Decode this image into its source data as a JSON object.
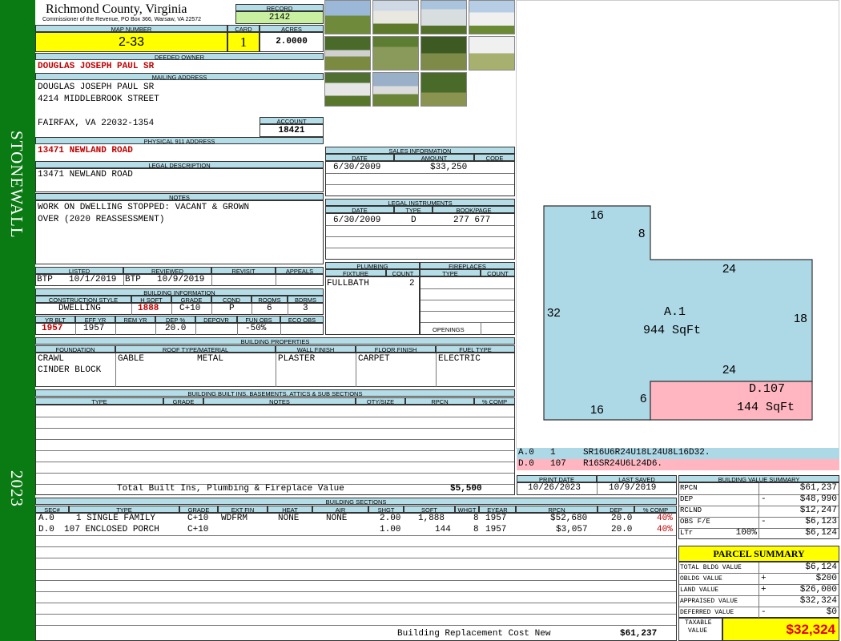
{
  "sidebar": {
    "district": "STONEWALL",
    "year": "2023"
  },
  "header": {
    "county": "Richmond County, Virginia",
    "commissioner": "Commissioner of the Revenue, PO Box 366, Warsaw, VA 22572",
    "record_label": "RECORD",
    "record": "2142",
    "map_label": "MAP NUMBER",
    "map": "2-33",
    "card_label": "CARD",
    "card": "1",
    "acres_label": "ACRES",
    "acres": "2.0000"
  },
  "owner": {
    "label": "DEEDED OWNER",
    "name": "DOUGLAS JOSEPH PAUL SR",
    "mailing_label": "MAILING ADDRESS",
    "mail1": "DOUGLAS JOSEPH PAUL SR",
    "mail2": "4214 MIDDLEBROOK STREET",
    "mail3": "FAIRFAX, VA 22032-1354",
    "account_label": "ACCOUNT",
    "account": "18421"
  },
  "physical": {
    "label": "PHYSICAL 911 ADDRESS",
    "address": "13471 NEWLAND ROAD"
  },
  "legal": {
    "label": "LEGAL DESCRIPTION",
    "text": "13471 NEWLAND ROAD"
  },
  "notes": {
    "label": "NOTES",
    "line1": "WORK ON DWELLING STOPPED: VACANT & GROWN",
    "line2": "OVER (2020 REASSESSMENT)"
  },
  "sales": {
    "label": "SALES INFORMATION",
    "cols": [
      "DATE",
      "AMOUNT",
      "CODE"
    ],
    "date": "6/30/2009",
    "amount": "$33,250",
    "code": ""
  },
  "instruments": {
    "label": "LEGAL INSTRUMENTS",
    "cols": [
      "DATE",
      "TYPE",
      "BOOK/PAGE"
    ],
    "date": "6/30/2009",
    "type": "D",
    "book": "277 677"
  },
  "status": {
    "listed_label": "LISTED",
    "listed_by": "BTP",
    "listed": "10/1/2019",
    "reviewed_label": "REVIEWED",
    "reviewed_by": "BTP",
    "reviewed": "10/9/2019",
    "revisit_label": "REVISIT",
    "appeals_label": "APPEALS"
  },
  "plumbing": {
    "label": "PLUMBING",
    "fixture_label": "FIXTURE",
    "count_label": "COUNT",
    "fixture": "FULLBATH",
    "count": "2"
  },
  "fireplaces": {
    "label": "FIREPLACES",
    "type_label": "TYPE",
    "count_label": "COUNT",
    "openings_label": "OPENINGS"
  },
  "building": {
    "label": "BUILDING INFORMATION",
    "cs_label": "CONSTRUCTION STYLE",
    "hsqft_label": "H SQFT",
    "grade_label": "GRADE",
    "cond_label": "COND",
    "rooms_label": "ROOMS",
    "bdrms_label": "BDRMS",
    "style": "DWELLING",
    "hsqft": "1888",
    "grade": "C+10",
    "cond": "P",
    "rooms": "6",
    "bdrms": "3",
    "yrblt_label": "YR BLT",
    "effyr_label": "EFF YR",
    "remyr_label": "REM YR",
    "dep_label": "DEP %",
    "depovr_label": "DEPOVR",
    "funobs_label": "FUN OBS",
    "ecoobs_label": "ECO OBS",
    "yrblt": "1957",
    "effyr": "1957",
    "dep": "20.0",
    "funobs": "-50%"
  },
  "properties": {
    "label": "BUILDING PROPERTIES",
    "foundation_label": "FOUNDATION",
    "roof_label": "ROOF TYPE/MATERIAL",
    "wall_label": "WALL FINISH",
    "floor_label": "FLOOR FINISH",
    "fuel_label": "FUEL TYPE",
    "foundation1": "CRAWL",
    "foundation2": "CINDER BLOCK",
    "roof_type": "GABLE",
    "roof_mat": "METAL",
    "wall": "PLASTER",
    "floor": "CARPET",
    "fuel": "ELECTRIC"
  },
  "builtins": {
    "label": "BUILDING BUILT INS, BASEMENTS, ATTICS & SUB SECTIONS",
    "cols": [
      "TYPE",
      "GRADE",
      "NOTES",
      "QTY/SIZE",
      "RPCN",
      "% COMP"
    ],
    "total_label": "Total Built Ins, Plumbing & Fireplace Value",
    "total": "$5,500"
  },
  "dates": {
    "print_label": "PRINT DATE",
    "print": "10/26/2023",
    "saved_label": "LAST SAVED",
    "saved": "10/9/2019"
  },
  "sections": {
    "label": "BUILDING SECTIONS",
    "cols": [
      "SEC#",
      "TYPE",
      "GRADE",
      "EXT FIN",
      "HEAT",
      "AIR",
      "SHGT",
      "SQFT",
      "WHGT",
      "EYEAR",
      "RPCN",
      "DEP",
      "% COMP"
    ],
    "rows": [
      {
        "sec": "A.0",
        "type": "1 SINGLE FAMILY",
        "grade": "C+10",
        "ext": "WDFRM",
        "heat": "NONE",
        "air": "NONE",
        "shgt": "2.00",
        "sqft": "1,888",
        "whgt": "8",
        "eyear": "1957",
        "rpcn": "$52,680",
        "dep": "20.0",
        "comp": "40%"
      },
      {
        "sec": "D.0",
        "type": "107 ENCLOSED PORCH",
        "grade": "C+10",
        "ext": "",
        "heat": "",
        "air": "",
        "shgt": "1.00",
        "sqft": "144",
        "whgt": "8",
        "eyear": "1957",
        "rpcn": "$3,057",
        "dep": "20.0",
        "comp": "40%"
      }
    ],
    "brcn_label": "Building Replacement Cost New",
    "brcn": "$61,237"
  },
  "sketch": {
    "main_label": "A.1",
    "main_area": "944 SqFt",
    "porch_label": "D.107",
    "porch_area": "144 SqFt",
    "dims": [
      "16",
      "8",
      "24",
      "32",
      "18",
      "24",
      "6",
      "16"
    ],
    "code_a": "A.0",
    "code_a_num": "1",
    "code_a_path": "SR16U6R24U18L24U8L16D32.",
    "code_d": "D.0",
    "code_d_num": "107",
    "code_d_path": "R16SR24U6L24D6.",
    "main_color": "#add8e6",
    "porch_color": "#ffb6c1"
  },
  "value_summary": {
    "label": "BUILDING VALUE SUMMARY",
    "rpcn_label": "RPCN",
    "rpcn": "$61,237",
    "dep_label": "DEP",
    "dep_sign": "-",
    "dep": "$48,990",
    "rclnd_label": "RCLND",
    "rclnd": "$12,247",
    "obs_label": "OBS F/E",
    "obs_sign": "-",
    "obs": "$6,123",
    "ltr_label": "LTr",
    "ltr_pct": "100%",
    "ltr": "$6,124"
  },
  "parcel": {
    "label": "PARCEL SUMMARY",
    "tbv_label": "TOTAL BLDG VALUE",
    "tbv": "$6,124",
    "obv_label": "OBLDG VALUE",
    "obv_sign": "+",
    "obv": "$200",
    "land_label": "LAND VALUE",
    "land_sign": "+",
    "land": "$26,000",
    "appr_label": "APPRAISED VALUE",
    "appr": "$32,324",
    "def_label": "DEFERRED VALUE",
    "def_sign": "-",
    "def": "$0",
    "tax_label1": "TAXABLE",
    "tax_label2": "VALUE",
    "taxable": "$32,324"
  },
  "colors": {
    "sidebar": "#0a7a12",
    "header": "#b4dde8",
    "yellow": "#ffff00",
    "record": "#c8f0a0"
  }
}
